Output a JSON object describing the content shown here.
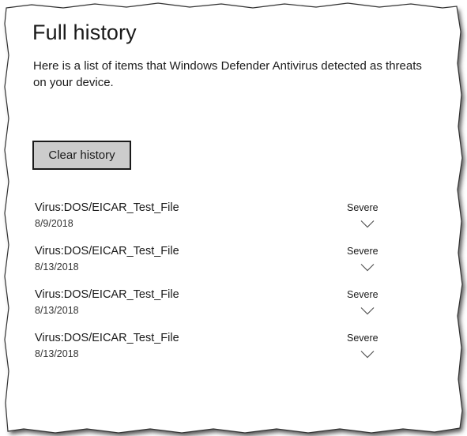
{
  "page": {
    "title": "Full history",
    "description": "Here is a list of items that Windows Defender Antivirus detected as threats on your device.",
    "clear_button_label": "Clear history"
  },
  "threats": [
    {
      "name": "Virus:DOS/EICAR_Test_File",
      "date": "8/9/2018",
      "severity": "Severe",
      "expand_icon": "chevron-down-icon"
    },
    {
      "name": "Virus:DOS/EICAR_Test_File",
      "date": "8/13/2018",
      "severity": "Severe",
      "expand_icon": "chevron-down-icon"
    },
    {
      "name": "Virus:DOS/EICAR_Test_File",
      "date": "8/13/2018",
      "severity": "Severe",
      "expand_icon": "chevron-down-icon"
    },
    {
      "name": "Virus:DOS/EICAR_Test_File",
      "date": "8/13/2018",
      "severity": "Severe",
      "expand_icon": "chevron-down-icon"
    }
  ],
  "colors": {
    "text": "#1a1a1a",
    "button_bg": "#cccccc",
    "background": "#ffffff"
  }
}
